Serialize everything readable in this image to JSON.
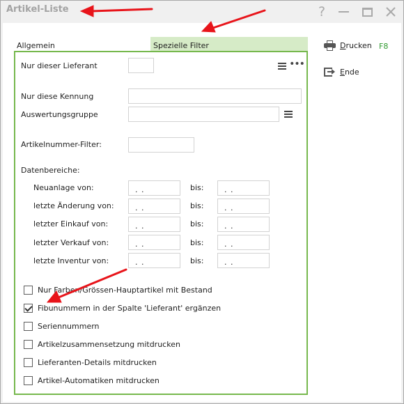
{
  "window": {
    "title": "Artikel-Liste",
    "help_glyph": "?",
    "controls": [
      "help-icon",
      "minimize-icon",
      "maximize-icon",
      "close-icon"
    ]
  },
  "tabs": [
    {
      "label": "Allgemein",
      "active": false
    },
    {
      "label": "Spezielle Filter",
      "active": true
    }
  ],
  "filters": {
    "lieferant_label": "Nur dieser Lieferant",
    "lieferant_value": "",
    "kennung_label": "Nur diese Kennung",
    "kennung_value": "",
    "gruppe_label": "Auswertungsgruppe",
    "gruppe_value": "",
    "artikelnummer_label": "Artikelnummer-Filter:",
    "artikelnummer_value": ""
  },
  "date_ranges": {
    "heading": "Datenbereiche:",
    "to_label": "bis:",
    "rows": [
      {
        "label": "Neuanlage von:",
        "from": ". .",
        "to": ". ."
      },
      {
        "label": "letzte Änderung von:",
        "from": ". .",
        "to": ". ."
      },
      {
        "label": "letzter Einkauf von:",
        "from": ". .",
        "to": ". ."
      },
      {
        "label": "letzter Verkauf von:",
        "from": ". .",
        "to": ". ."
      },
      {
        "label": "letzte Inventur von:",
        "from": ". .",
        "to": ". ."
      }
    ]
  },
  "options": [
    {
      "label": "Nur Farben/Grössen-Hauptartikel mit Bestand",
      "checked": false
    },
    {
      "label": "Fibunummern in der Spalte 'Lieferant' ergänzen",
      "checked": true
    },
    {
      "label": "Seriennummern",
      "checked": false
    },
    {
      "label": "Artikelzusammensetzung mitdrucken",
      "checked": false
    },
    {
      "label": "Lieferanten-Details mitdrucken",
      "checked": false
    },
    {
      "label": "Artikel-Automatiken mitdrucken",
      "checked": false
    }
  ],
  "actions": {
    "print_hotkey": "D",
    "print_rest": "rucken",
    "print_shortcut": "F8",
    "exit_hotkey": "E",
    "exit_rest": "nde"
  },
  "colors": {
    "accent_green": "#76b84d",
    "active_tab_bg": "#d6ebc7",
    "annotation_arrow": "#e8141a",
    "shortcut_text": "#2f9a2f"
  }
}
